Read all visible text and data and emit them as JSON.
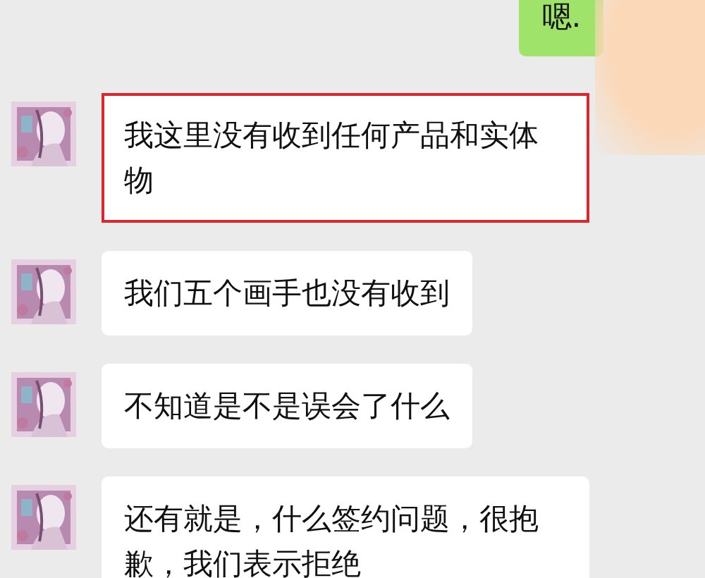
{
  "messages": [
    {
      "kind": "sent",
      "text": "嗯."
    },
    {
      "kind": "received",
      "text": "我这里没有收到任何产品和实体物",
      "highlighted": true
    },
    {
      "kind": "received",
      "text": "我们五个画手也没有收到",
      "highlighted": false
    },
    {
      "kind": "received",
      "text": "不知道是不是误会了什么",
      "highlighted": false
    },
    {
      "kind": "received",
      "text": "还有就是，什么签约问题，很抱歉，我们表示拒绝",
      "highlighted": false
    }
  ]
}
